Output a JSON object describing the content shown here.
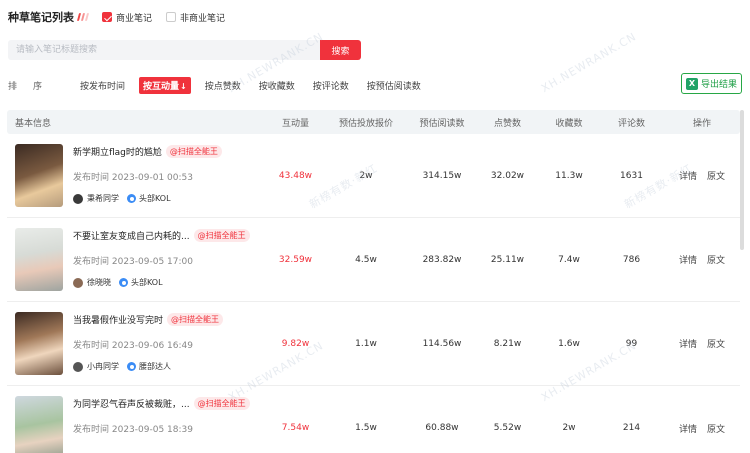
{
  "header": {
    "title": "种草笔记列表",
    "filters": [
      {
        "label": "商业笔记",
        "checked": true
      },
      {
        "label": "非商业笔记",
        "checked": false
      }
    ]
  },
  "search": {
    "placeholder": "请输入笔记标题搜索",
    "value": "",
    "button_label": "搜索"
  },
  "sort": {
    "label": "排序",
    "options": [
      {
        "label": "按发布时间",
        "active": false
      },
      {
        "label": "按互动量",
        "active": true,
        "arrow": "↓"
      },
      {
        "label": "按点赞数",
        "active": false
      },
      {
        "label": "按收藏数",
        "active": false
      },
      {
        "label": "按评论数",
        "active": false
      },
      {
        "label": "按预估阅读数",
        "active": false
      }
    ],
    "export_label": "导出结果"
  },
  "table": {
    "headers": [
      "基本信息",
      "互动量",
      "预估投放报价",
      "预估阅读数",
      "点赞数",
      "收藏数",
      "评论数",
      "操作"
    ],
    "detail_label": "详情",
    "source_label": "原文",
    "rows": [
      {
        "title": "新学期立flag时的尴尬",
        "tag": "@扫描全能王",
        "pubtime": "发布时间 2023-09-01 00:53",
        "author": "秉希同学",
        "level": "头部KOL",
        "interactions": "43.48w",
        "price": "2w",
        "reads": "314.15w",
        "likes": "32.02w",
        "favorites": "11.3w",
        "comments": "1631"
      },
      {
        "title": "不要让室友变成自己内耗的...",
        "tag": "@扫描全能王",
        "pubtime": "发布时间 2023-09-05 17:00",
        "author": "徐晓晓",
        "level": "头部KOL",
        "interactions": "32.59w",
        "price": "4.5w",
        "reads": "283.82w",
        "likes": "25.11w",
        "favorites": "7.4w",
        "comments": "786"
      },
      {
        "title": "当我暑假作业没写完时",
        "tag": "@扫描全能王",
        "pubtime": "发布时间 2023-09-06 16:49",
        "author": "小冉同学",
        "level": "腰部达人",
        "interactions": "9.82w",
        "price": "1.1w",
        "reads": "114.56w",
        "likes": "8.21w",
        "favorites": "1.6w",
        "comments": "99"
      },
      {
        "title": "为同学忍气吞声反被裁赃，...",
        "tag": "@扫描全能王",
        "pubtime": "发布时间 2023-09-05 18:39",
        "author": "",
        "level": "",
        "interactions": "7.54w",
        "price": "1.5w",
        "reads": "60.88w",
        "likes": "5.52w",
        "favorites": "2w",
        "comments": "214"
      }
    ]
  },
  "watermark": {
    "brand": "XH.NEWRANK.CN",
    "cn": "新榜有数·新红"
  },
  "colors": {
    "accent": "#f0323c",
    "export_green": "#1d9e45",
    "header_bg": "#f1f4f6"
  }
}
